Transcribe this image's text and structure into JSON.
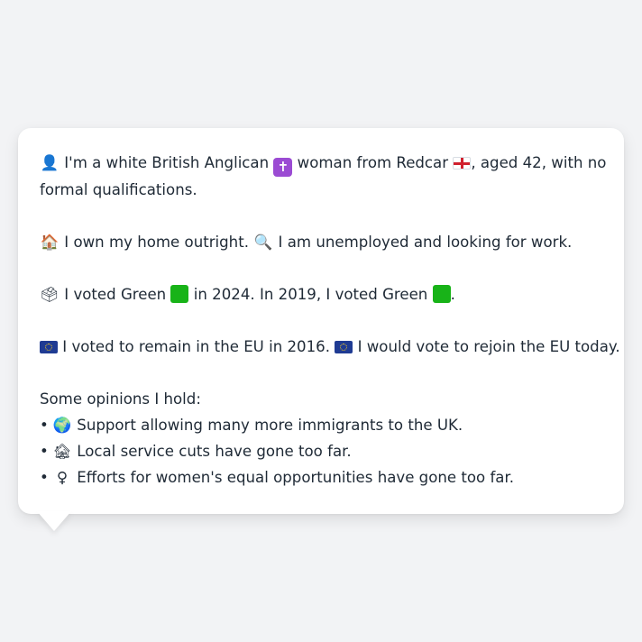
{
  "card": {
    "identity": {
      "icon": "bust-in-silhouette-icon",
      "glyph": "👤",
      "line1_a": "I'm a white British Anglican",
      "religion_icon": "latin-cross-icon",
      "religion_glyph": "✝",
      "line1_b": "woman from Redcar",
      "flag_icon": "england-flag-icon",
      "line1_c": ", aged 42, with no",
      "line2": "formal qualifications."
    },
    "housing": {
      "home_icon": "house-icon",
      "home_glyph": "🏠",
      "home_text": "I own my home outright.",
      "work_icon": "magnifying-glass-icon",
      "work_glyph": "🔍",
      "work_text": "I am unemployed and looking for work."
    },
    "voting": {
      "icon": "ballot-box-icon",
      "glyph": "🗳",
      "text_a": "I voted Green",
      "party_color": "#18b318",
      "text_b": "in 2024. In 2019, I voted Green",
      "text_c": "."
    },
    "eu": {
      "flag_icon": "eu-flag-icon",
      "text_a": "I voted to remain in the EU in 2016.",
      "text_b": "I would vote to rejoin the EU today."
    },
    "opinions": {
      "heading": "Some opinions I hold:",
      "bullet": "•",
      "items": [
        {
          "icon": "globe-icon",
          "glyph": "🌍",
          "text": "Support allowing many more immigrants to the UK."
        },
        {
          "icon": "derelict-house-icon",
          "glyph": "🏚",
          "text": "Local service cuts have gone too far."
        },
        {
          "icon": "female-sign-icon",
          "glyph": "♀",
          "text": "Efforts for women's equal opportunities have gone too far."
        }
      ]
    }
  }
}
